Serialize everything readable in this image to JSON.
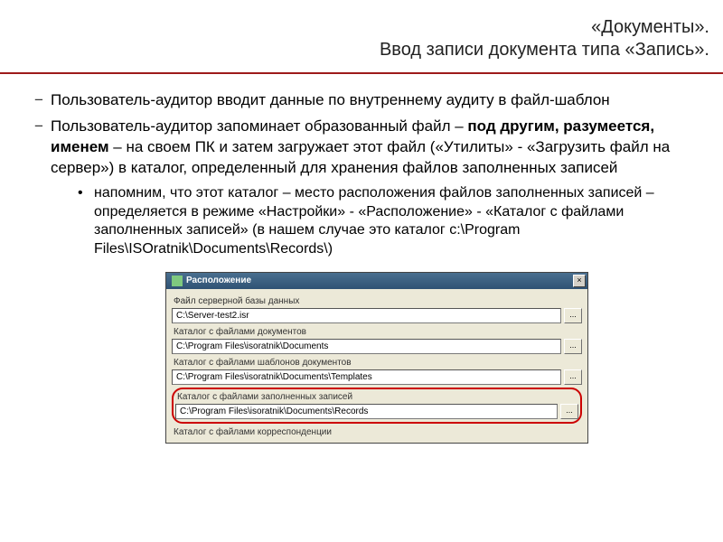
{
  "header": {
    "line1": "«Документы».",
    "line2": "Ввод записи документа типа «Запись»."
  },
  "bullets": {
    "item1": "Пользователь-аудитор вводит данные по внутреннему аудиту в файл-шаблон",
    "item2_a": "Пользователь-аудитор запоминает образованный файл – ",
    "item2_bold": "под другим, разумеется, именем",
    "item2_b": " – на своем ПК и затем загружает этот файл («Утилиты» - «Загрузить файл на сервер») в каталог, определенный для хранения файлов заполненных записей",
    "sub1": "напомним, что этот каталог – место расположения файлов заполненных записей – определяется в режиме «Настройки» - «Расположение» - «Каталог с файлами заполненных записей» (в нашем случае это каталог c:\\Program Files\\ISOratnik\\Documents\\Records\\)"
  },
  "dialog": {
    "title": "Расположение",
    "close": "×",
    "browse": "...",
    "fields": {
      "f1": {
        "label": "Файл серверной базы данных",
        "value": "C:\\Server-test2.isr"
      },
      "f2": {
        "label": "Каталог с файлами документов",
        "value": "C:\\Program Files\\isoratnik\\Documents"
      },
      "f3": {
        "label": "Каталог с файлами шаблонов документов",
        "value": "C:\\Program Files\\isoratnik\\Documents\\Templates"
      },
      "f4": {
        "label": "Каталог с файлами заполненных записей",
        "value": "C:\\Program Files\\isoratnik\\Documents\\Records"
      },
      "f5": {
        "label": "Каталог с файлами корреспонденции"
      }
    }
  }
}
